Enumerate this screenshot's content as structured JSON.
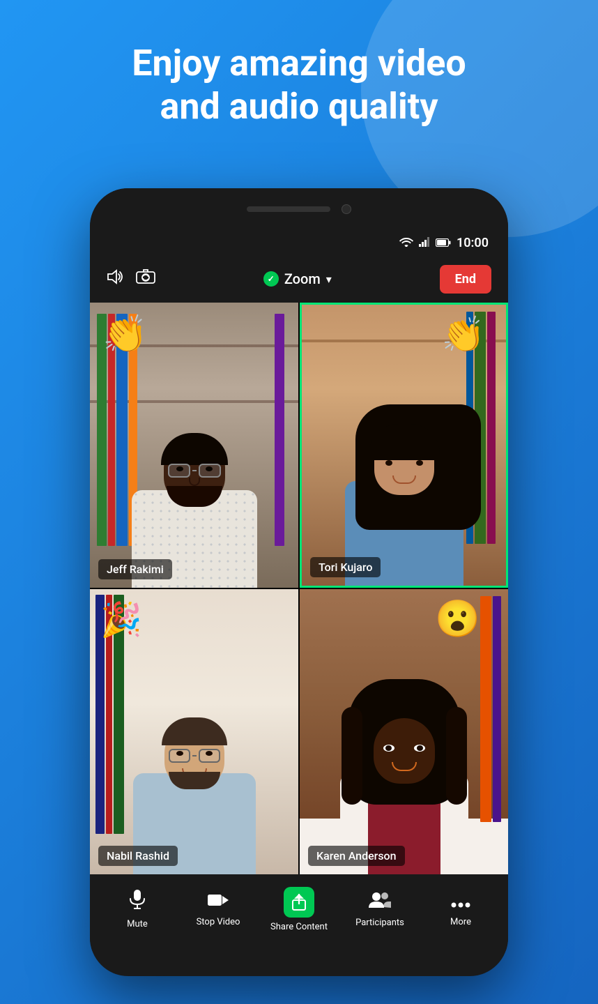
{
  "hero": {
    "text_line1": "Enjoy amazing video",
    "text_line2": "and audio quality"
  },
  "status_bar": {
    "time": "10:00"
  },
  "meeting": {
    "title": "Zoom",
    "end_label": "End"
  },
  "participants": [
    {
      "name": "Jeff Rakimi",
      "emoji": "👏",
      "active": false,
      "skin": "dark",
      "hair": "black",
      "glasses": true,
      "beard": true
    },
    {
      "name": "Tori Kujaro",
      "emoji": "👏",
      "active": true,
      "skin": "medium",
      "hair": "dark-long"
    },
    {
      "name": "Nabil Rashid",
      "emoji": "🎉",
      "active": false,
      "skin": "medium-light",
      "hair": "brown",
      "glasses": true,
      "beard": true
    },
    {
      "name": "Karen Anderson",
      "emoji": "😮",
      "active": false,
      "skin": "dark",
      "hair": "black-curly"
    }
  ],
  "bottom_nav": {
    "items": [
      {
        "label": "Mute",
        "icon": "mic"
      },
      {
        "label": "Stop Video",
        "icon": "video"
      },
      {
        "label": "Share Content",
        "icon": "share"
      },
      {
        "label": "Participants",
        "icon": "participants"
      },
      {
        "label": "More",
        "icon": "more"
      }
    ]
  }
}
